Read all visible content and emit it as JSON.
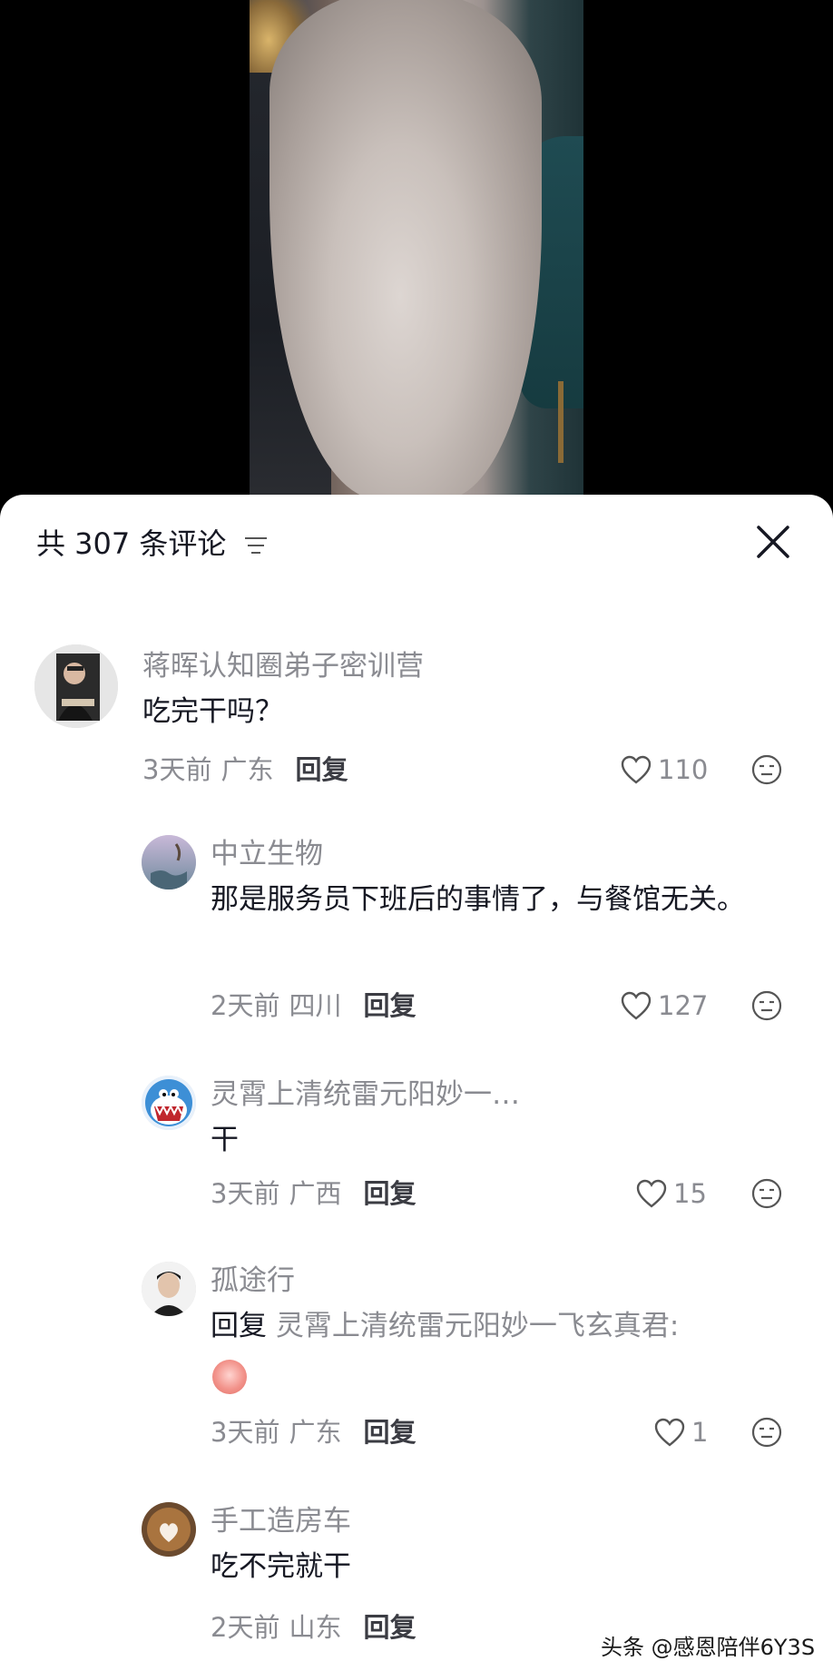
{
  "sheet": {
    "comment_count_label": "共 307 条评论"
  },
  "comments": [
    {
      "user": "蒋晖认知圈弟子密训营",
      "text": "吃完干吗？",
      "time": "3天前",
      "location": "广东",
      "reply_label": "回复",
      "likes": "110"
    },
    {
      "user": "中立生物",
      "text": "那是服务员下班后的事情了，与餐馆无关。",
      "time": "2天前",
      "location": "四川",
      "reply_label": "回复",
      "likes": "127"
    },
    {
      "user": "灵霄上清统雷元阳妙一…",
      "text": "干",
      "time": "3天前",
      "location": "广西",
      "reply_label": "回复",
      "likes": "15"
    },
    {
      "user": "孤途行",
      "reply_prefix": "回复",
      "reply_target": "灵霄上清统雷元阳妙一飞玄真君:",
      "time": "3天前",
      "location": "广东",
      "reply_label": "回复",
      "likes": "1"
    },
    {
      "user": "手工造房车",
      "text": "吃不完就干",
      "time": "2天前",
      "location": "山东",
      "reply_label": "回复"
    }
  ],
  "watermark": "头条 @感恩陪伴6Y3S",
  "colors": {
    "text_primary": "#161823",
    "text_secondary": "#8a8b91",
    "sheet_bg": "#ffffff"
  }
}
